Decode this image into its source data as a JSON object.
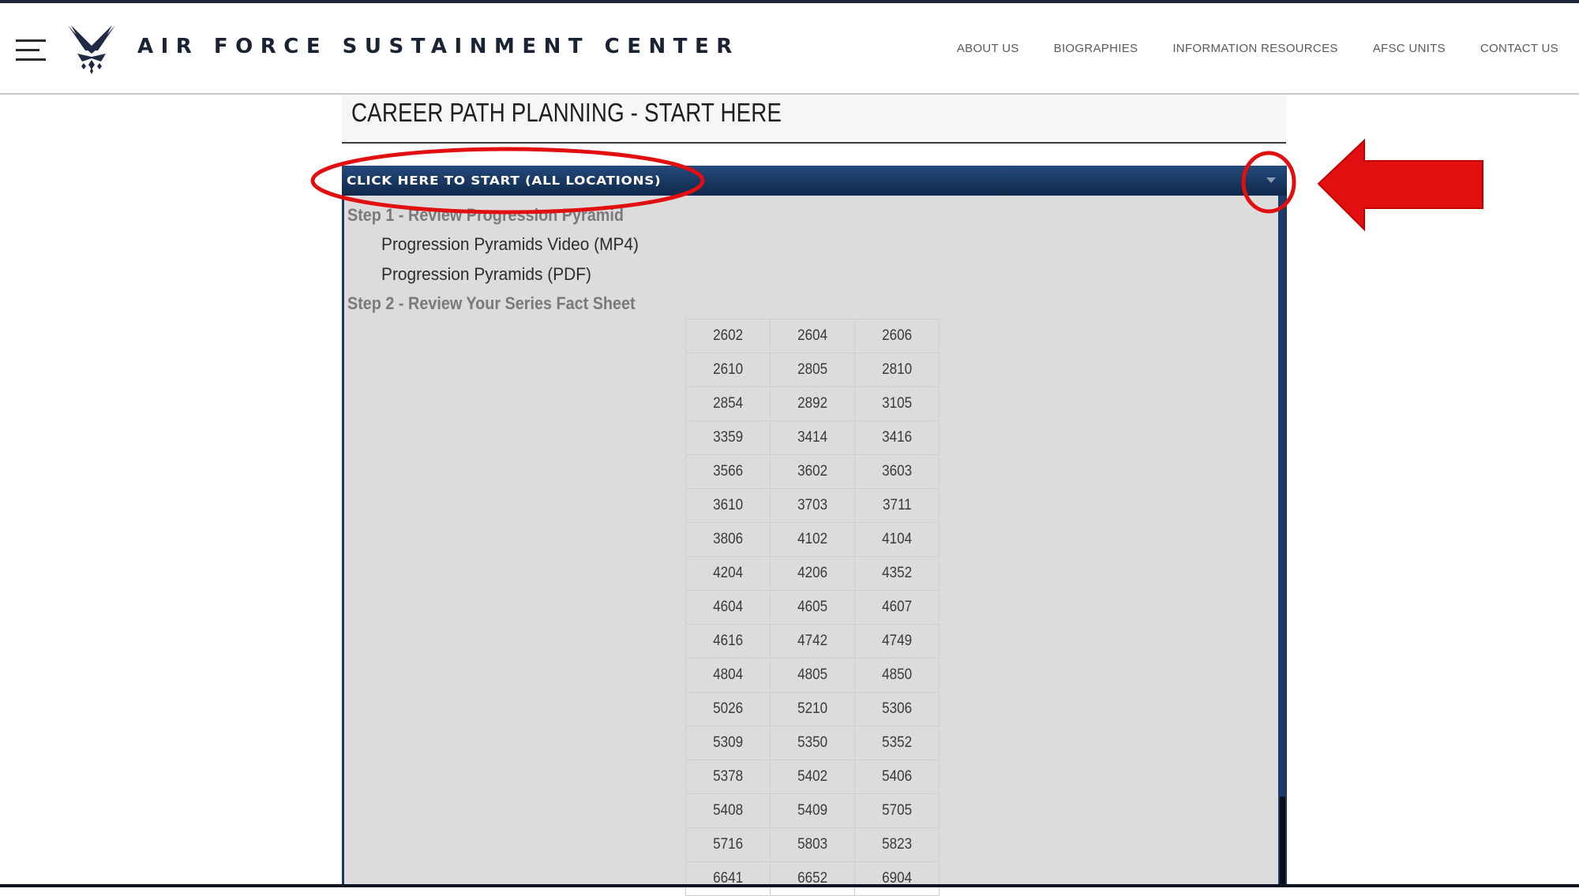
{
  "header": {
    "site_title": "AIR FORCE SUSTAINMENT CENTER",
    "nav": [
      "ABOUT US",
      "BIOGRAPHIES",
      "INFORMATION RESOURCES",
      "AFSC UNITS",
      "CONTACT US"
    ]
  },
  "page": {
    "title": "CAREER PATH PLANNING - START HERE"
  },
  "accordion": {
    "header_label": "CLICK HERE TO START (ALL LOCATIONS)",
    "step1": "Step 1 - Review Progression Pyramid",
    "step1_links": [
      "Progression Pyramids Video (MP4)",
      "Progression Pyramids (PDF)"
    ],
    "step2": "Step 2 - Review Your Series Fact Sheet",
    "series": [
      [
        "2602",
        "2604",
        "2606"
      ],
      [
        "2610",
        "2805",
        "2810"
      ],
      [
        "2854",
        "2892",
        "3105"
      ],
      [
        "3359",
        "3414",
        "3416"
      ],
      [
        "3566",
        "3602",
        "3603"
      ],
      [
        "3610",
        "3703",
        "3711"
      ],
      [
        "3806",
        "4102",
        "4104"
      ],
      [
        "4204",
        "4206",
        "4352"
      ],
      [
        "4604",
        "4605",
        "4607"
      ],
      [
        "4616",
        "4742",
        "4749"
      ],
      [
        "4804",
        "4805",
        "4850"
      ],
      [
        "5026",
        "5210",
        "5306"
      ],
      [
        "5309",
        "5350",
        "5352"
      ],
      [
        "5378",
        "5402",
        "5406"
      ],
      [
        "5408",
        "5409",
        "5705"
      ],
      [
        "5716",
        "5803",
        "5823"
      ],
      [
        "6641",
        "6652",
        "6904"
      ]
    ]
  },
  "colors": {
    "accordion_header": "#1b3a66",
    "annotation_red": "#e10f0f",
    "body_panel": "#dcdcdc"
  },
  "icons": [
    "hamburger-menu-icon",
    "air-force-wings-logo",
    "chevron-down-icon",
    "red-arrow-annotation"
  ]
}
